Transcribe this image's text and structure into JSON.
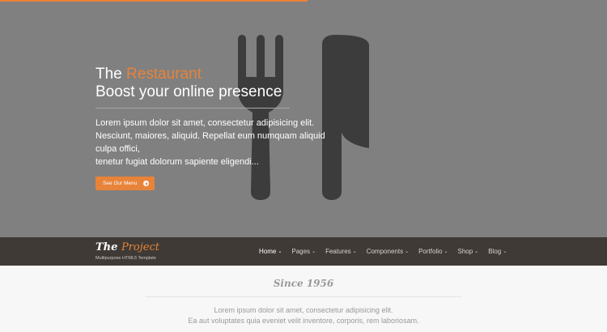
{
  "hero": {
    "title_prefix": "The",
    "title_accent": "Restaurant",
    "subtitle": "Boost your online presence",
    "lines": [
      "Lorem ipsum dolor sit amet, consectetur adipisicing elit.",
      "Nesciunt, maiores, aliquid. Repellat eum numquam aliquid culpa offici,",
      "tenetur fugiat dolorum sapiente eligendi..."
    ],
    "button_label": "See Our Menu",
    "graphic_icon": "fork-knife-icon",
    "colors": {
      "background": "#808080",
      "graphic": "#3c3c3c",
      "accent": "#e8833a"
    }
  },
  "navbar": {
    "logo_prefix": "The",
    "logo_accent": "Project",
    "tagline": "Multipurpose HTML5 Template",
    "items": [
      {
        "label": "Home"
      },
      {
        "label": "Pages"
      },
      {
        "label": "Features"
      },
      {
        "label": "Components"
      },
      {
        "label": "Portfolio"
      },
      {
        "label": "Shop"
      },
      {
        "label": "Blog"
      }
    ],
    "active_item": "Home",
    "background": "#3f3a36"
  },
  "section": {
    "heading": "Since 1956",
    "lines": [
      "Lorem ipsum dolor sit amet, consectetur adipisicing elit.",
      "Ea aut voluptates quia eveniet velit inventore, corporis, rem laboriosam."
    ]
  }
}
